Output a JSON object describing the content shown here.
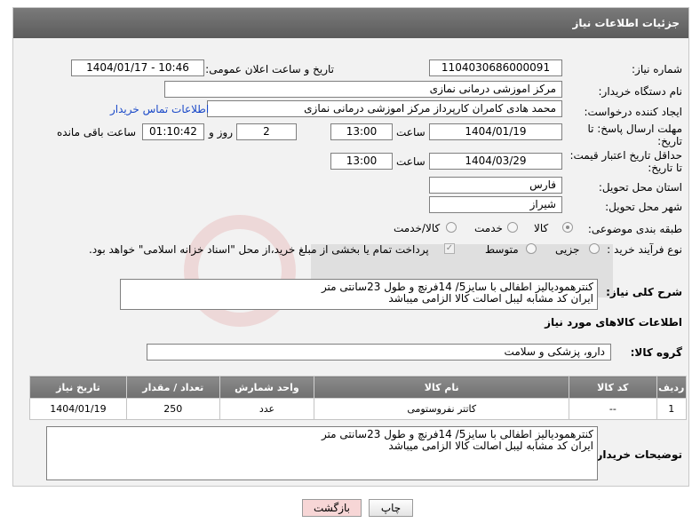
{
  "header": {
    "title": "جزئیات اطلاعات نیاز"
  },
  "fields": {
    "need_number_label": "شماره نیاز:",
    "need_number": "1104030686000091",
    "announce_label": "تاریخ و ساعت اعلان عمومی:",
    "announce_value": "1404/01/17 - 10:46",
    "buyer_org_label": "نام دستگاه خریدار:",
    "buyer_org": "مرکز اموزشی درمانی نمازی",
    "creator_label": "ایجاد کننده درخواست:",
    "creator": "محمد هادی کامران کارپرداز مرکز اموزشی درمانی نمازی",
    "contact_link": "اطلاعات تماس خریدار",
    "deadline_label_1": "مهلت ارسال پاسخ: تا",
    "deadline_label_2": "تاریخ:",
    "deadline_date": "1404/01/19",
    "time_label": "ساعت",
    "deadline_time": "13:00",
    "days_value": "2",
    "days_label": "روز و",
    "remaining_time": "01:10:42",
    "remaining_label": "ساعت باقی مانده",
    "validity_label_1": "حداقل تاریخ اعتبار قیمت:",
    "validity_label_2": "تا تاریخ:",
    "validity_date": "1404/03/29",
    "validity_time": "13:00",
    "province_label": "استان محل تحویل:",
    "province": "فارس",
    "city_label": "شهر محل تحویل:",
    "city": "شیراز",
    "category_label": "طبقه بندی موضوعی:",
    "category_options": [
      "کالا",
      "خدمت",
      "کالا/خدمت"
    ],
    "category_selected": "کالا",
    "process_label": "نوع فرآیند خرید :",
    "process_options": [
      "جزیی",
      "متوسط"
    ],
    "payment_note": "پرداخت تمام یا بخشی از مبلغ خرید،از محل \"اسناد خزانه اسلامی\" خواهد بود.",
    "summary_label": "شرح کلی نیاز:",
    "summary_line1": "کنترهمودیالیز اطفالی با سایز5/ 14فرنچ و طول 23سانتی متر",
    "summary_line2": "ایران کد مشابه لیبل اصالت کالا الزامی میباشد",
    "goods_info_title": "اطلاعات کالاهای مورد نیاز",
    "goods_group_label": "گروه کالا:",
    "goods_group": "دارو، پزشکی و سلامت",
    "buyer_notes_label": "توضیحات خریدار:",
    "buyer_notes_line1": "کنترهمودیالیز اطفالی با سایز5/ 14فرنچ و طول 23سانتی متر",
    "buyer_notes_line2": "ایران کد مشابه لیبل اصالت کالا الزامی میباشد"
  },
  "table": {
    "headers": [
      "ردیف",
      "کد کالا",
      "نام کالا",
      "واحد شمارش",
      "تعداد / مقدار",
      "تاریخ نیاز"
    ],
    "rows": [
      [
        "1",
        "--",
        "کاتتر نفروستومی",
        "عدد",
        "250",
        "1404/01/19"
      ]
    ]
  },
  "buttons": {
    "print": "چاپ",
    "back": "بازگشت"
  },
  "colors": {
    "header_bg": "#6b6b6b",
    "link": "#1a49c8",
    "back_button_bg": "#f7d6d6"
  }
}
